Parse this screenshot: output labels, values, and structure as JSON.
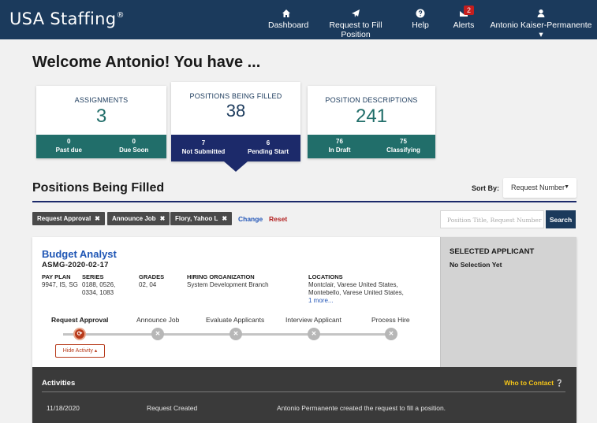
{
  "app": {
    "logo": "USA Staffing",
    "logo_mark": "®"
  },
  "nav": {
    "dashboard": "Dashboard",
    "request_to_fill": "Request to Fill Position",
    "help": "Help",
    "alerts": "Alerts",
    "alerts_count": "2",
    "user": "Antonio Kaiser-Permanente ▾"
  },
  "welcome": "Welcome Antonio! You have ...",
  "cards": {
    "assignments": {
      "title": "ASSIGNMENTS",
      "count": "3",
      "f1_num": "0",
      "f1_lbl": "Past due",
      "f2_num": "0",
      "f2_lbl": "Due Soon"
    },
    "positions": {
      "title": "POSITIONS BEING FILLED",
      "count": "38",
      "f1_num": "7",
      "f1_lbl": "Not Submitted",
      "f2_num": "6",
      "f2_lbl": "Pending Start"
    },
    "descriptions": {
      "title": "POSITION DESCRIPTIONS",
      "count": "241",
      "f1_num": "76",
      "f1_lbl": "In Draft",
      "f2_num": "75",
      "f2_lbl": "Classifying"
    }
  },
  "section": {
    "title": "Positions Being Filled",
    "sort_label": "Sort By:",
    "sort_value": "Request Number"
  },
  "filters": {
    "chips": [
      "Request Approval",
      "Announce Job",
      "Flory, Yahoo L"
    ],
    "change": "Change",
    "reset": "Reset",
    "search_placeholder": "Position Title, Request Number",
    "search_button": "Search"
  },
  "position": {
    "title": "Budget Analyst",
    "code": "ASMG-2020-02-17",
    "pay_plan_label": "PAY PLAN",
    "pay_plan": "9947, IS, SG",
    "series_label": "SERIES",
    "series_line1": "0188, 0526,",
    "series_line2": "0334, 1083",
    "grades_label": "GRADES",
    "grades": "02, 04",
    "org_label": "HIRING ORGANIZATION",
    "org": "System Development Branch",
    "loc_label": "LOCATIONS",
    "loc_line1": "Montclair, Varese United States,",
    "loc_line2": "Montebello, Varese United States,",
    "loc_more": "1 more...",
    "steps": [
      "Request Approval",
      "Announce Job",
      "Evaluate Applicants",
      "Interview Applicant",
      "Process Hire"
    ],
    "hide_activity": "Hide Activity ▴"
  },
  "applicant": {
    "title": "SELECTED APPLICANT",
    "value": "No Selection Yet"
  },
  "activities": {
    "title": "Activities",
    "who": "Who to Contact",
    "row": {
      "date": "11/18/2020",
      "action": "Request Created",
      "desc": "Antonio Permanente created the request to fill a position."
    }
  },
  "colors": {
    "nav": "#1b3a5c",
    "teal": "#216e6a",
    "navy": "#1c2a6a",
    "link": "#1f56b5",
    "reset": "#b32121",
    "current_step": "#b73a1a"
  }
}
